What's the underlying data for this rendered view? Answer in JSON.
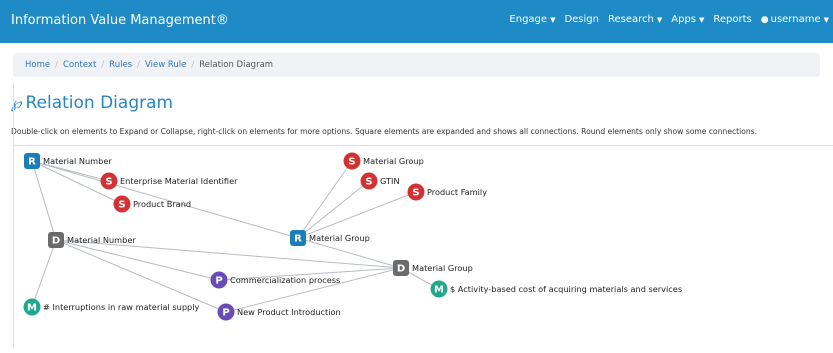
{
  "app": {
    "title": "Information Value Management®"
  },
  "nav": {
    "engage": "Engage",
    "design": "Design",
    "research": "Research",
    "apps": "Apps",
    "reports": "Reports",
    "username": "username"
  },
  "breadcrumb": {
    "home": "Home",
    "context": "Context",
    "rules": "Rules",
    "view_rule": "View Rule",
    "current": "Relation Diagram"
  },
  "page": {
    "title": "Relation Diagram",
    "instructions": "Double-click on elements to Expand or Collapse, right-click on elements for more options. Square elements are expanded and shows all connections. Round elements only show some connections."
  },
  "colors": {
    "R": "#1c7eb8",
    "D": "#6b6b6b",
    "S": "#d23234",
    "P": "#6a4cb8",
    "M": "#21a88c",
    "edge": "#b7bcc4"
  },
  "diagram": {
    "nodes": [
      {
        "id": "r_matnum",
        "badge": "R",
        "kind": "R",
        "label": "Material Number"
      },
      {
        "id": "s_emi",
        "badge": "S",
        "kind": "S",
        "label": "Enterprise Material Identifier"
      },
      {
        "id": "s_brand",
        "badge": "S",
        "kind": "S",
        "label": "Product Brand"
      },
      {
        "id": "d_matnum",
        "badge": "D",
        "kind": "D",
        "label": "Material Number"
      },
      {
        "id": "m_interrupt",
        "badge": "M",
        "kind": "M",
        "label": "# Interruptions in raw material supply"
      },
      {
        "id": "s_matgroup",
        "badge": "S",
        "kind": "S",
        "label": "Material Group"
      },
      {
        "id": "s_gtin",
        "badge": "S",
        "kind": "S",
        "label": "GTIN"
      },
      {
        "id": "s_family",
        "badge": "S",
        "kind": "S",
        "label": "Product Family"
      },
      {
        "id": "r_matgroup",
        "badge": "R",
        "kind": "R",
        "label": "Material Group"
      },
      {
        "id": "d_matgroup",
        "badge": "D",
        "kind": "D",
        "label": "Material Group"
      },
      {
        "id": "p_comm",
        "badge": "P",
        "kind": "P",
        "label": "Commercialization process"
      },
      {
        "id": "p_npi",
        "badge": "P",
        "kind": "P",
        "label": "New Product Introduction"
      },
      {
        "id": "m_abc",
        "badge": "M",
        "kind": "M",
        "label": "$ Activity-based cost of acquiring materials and services"
      }
    ],
    "edges": [
      [
        "r_matnum",
        "s_emi"
      ],
      [
        "r_matnum",
        "s_brand"
      ],
      [
        "r_matnum",
        "d_matnum"
      ],
      [
        "r_matnum",
        "r_matgroup"
      ],
      [
        "d_matnum",
        "m_interrupt"
      ],
      [
        "d_matnum",
        "p_comm"
      ],
      [
        "d_matnum",
        "p_npi"
      ],
      [
        "d_matnum",
        "d_matgroup"
      ],
      [
        "r_matgroup",
        "s_matgroup"
      ],
      [
        "r_matgroup",
        "s_gtin"
      ],
      [
        "r_matgroup",
        "s_family"
      ],
      [
        "r_matgroup",
        "d_matgroup"
      ],
      [
        "d_matgroup",
        "p_comm"
      ],
      [
        "d_matgroup",
        "p_npi"
      ],
      [
        "d_matgroup",
        "m_abc"
      ]
    ]
  }
}
